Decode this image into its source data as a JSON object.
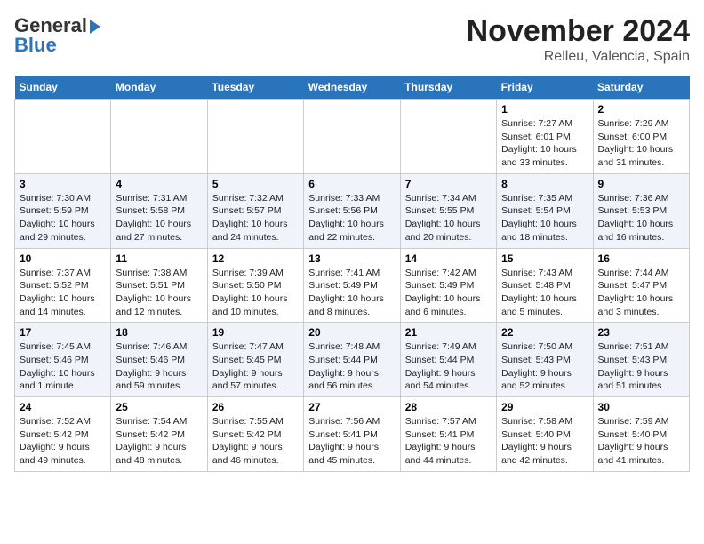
{
  "header": {
    "logo_line1": "General",
    "logo_line2": "Blue",
    "title": "November 2024",
    "subtitle": "Relleu, Valencia, Spain"
  },
  "weekdays": [
    "Sunday",
    "Monday",
    "Tuesday",
    "Wednesday",
    "Thursday",
    "Friday",
    "Saturday"
  ],
  "weeks": [
    [
      {
        "day": "",
        "info": ""
      },
      {
        "day": "",
        "info": ""
      },
      {
        "day": "",
        "info": ""
      },
      {
        "day": "",
        "info": ""
      },
      {
        "day": "",
        "info": ""
      },
      {
        "day": "1",
        "info": "Sunrise: 7:27 AM\nSunset: 6:01 PM\nDaylight: 10 hours and 33 minutes."
      },
      {
        "day": "2",
        "info": "Sunrise: 7:29 AM\nSunset: 6:00 PM\nDaylight: 10 hours and 31 minutes."
      }
    ],
    [
      {
        "day": "3",
        "info": "Sunrise: 7:30 AM\nSunset: 5:59 PM\nDaylight: 10 hours and 29 minutes."
      },
      {
        "day": "4",
        "info": "Sunrise: 7:31 AM\nSunset: 5:58 PM\nDaylight: 10 hours and 27 minutes."
      },
      {
        "day": "5",
        "info": "Sunrise: 7:32 AM\nSunset: 5:57 PM\nDaylight: 10 hours and 24 minutes."
      },
      {
        "day": "6",
        "info": "Sunrise: 7:33 AM\nSunset: 5:56 PM\nDaylight: 10 hours and 22 minutes."
      },
      {
        "day": "7",
        "info": "Sunrise: 7:34 AM\nSunset: 5:55 PM\nDaylight: 10 hours and 20 minutes."
      },
      {
        "day": "8",
        "info": "Sunrise: 7:35 AM\nSunset: 5:54 PM\nDaylight: 10 hours and 18 minutes."
      },
      {
        "day": "9",
        "info": "Sunrise: 7:36 AM\nSunset: 5:53 PM\nDaylight: 10 hours and 16 minutes."
      }
    ],
    [
      {
        "day": "10",
        "info": "Sunrise: 7:37 AM\nSunset: 5:52 PM\nDaylight: 10 hours and 14 minutes."
      },
      {
        "day": "11",
        "info": "Sunrise: 7:38 AM\nSunset: 5:51 PM\nDaylight: 10 hours and 12 minutes."
      },
      {
        "day": "12",
        "info": "Sunrise: 7:39 AM\nSunset: 5:50 PM\nDaylight: 10 hours and 10 minutes."
      },
      {
        "day": "13",
        "info": "Sunrise: 7:41 AM\nSunset: 5:49 PM\nDaylight: 10 hours and 8 minutes."
      },
      {
        "day": "14",
        "info": "Sunrise: 7:42 AM\nSunset: 5:49 PM\nDaylight: 10 hours and 6 minutes."
      },
      {
        "day": "15",
        "info": "Sunrise: 7:43 AM\nSunset: 5:48 PM\nDaylight: 10 hours and 5 minutes."
      },
      {
        "day": "16",
        "info": "Sunrise: 7:44 AM\nSunset: 5:47 PM\nDaylight: 10 hours and 3 minutes."
      }
    ],
    [
      {
        "day": "17",
        "info": "Sunrise: 7:45 AM\nSunset: 5:46 PM\nDaylight: 10 hours and 1 minute."
      },
      {
        "day": "18",
        "info": "Sunrise: 7:46 AM\nSunset: 5:46 PM\nDaylight: 9 hours and 59 minutes."
      },
      {
        "day": "19",
        "info": "Sunrise: 7:47 AM\nSunset: 5:45 PM\nDaylight: 9 hours and 57 minutes."
      },
      {
        "day": "20",
        "info": "Sunrise: 7:48 AM\nSunset: 5:44 PM\nDaylight: 9 hours and 56 minutes."
      },
      {
        "day": "21",
        "info": "Sunrise: 7:49 AM\nSunset: 5:44 PM\nDaylight: 9 hours and 54 minutes."
      },
      {
        "day": "22",
        "info": "Sunrise: 7:50 AM\nSunset: 5:43 PM\nDaylight: 9 hours and 52 minutes."
      },
      {
        "day": "23",
        "info": "Sunrise: 7:51 AM\nSunset: 5:43 PM\nDaylight: 9 hours and 51 minutes."
      }
    ],
    [
      {
        "day": "24",
        "info": "Sunrise: 7:52 AM\nSunset: 5:42 PM\nDaylight: 9 hours and 49 minutes."
      },
      {
        "day": "25",
        "info": "Sunrise: 7:54 AM\nSunset: 5:42 PM\nDaylight: 9 hours and 48 minutes."
      },
      {
        "day": "26",
        "info": "Sunrise: 7:55 AM\nSunset: 5:42 PM\nDaylight: 9 hours and 46 minutes."
      },
      {
        "day": "27",
        "info": "Sunrise: 7:56 AM\nSunset: 5:41 PM\nDaylight: 9 hours and 45 minutes."
      },
      {
        "day": "28",
        "info": "Sunrise: 7:57 AM\nSunset: 5:41 PM\nDaylight: 9 hours and 44 minutes."
      },
      {
        "day": "29",
        "info": "Sunrise: 7:58 AM\nSunset: 5:40 PM\nDaylight: 9 hours and 42 minutes."
      },
      {
        "day": "30",
        "info": "Sunrise: 7:59 AM\nSunset: 5:40 PM\nDaylight: 9 hours and 41 minutes."
      }
    ]
  ]
}
